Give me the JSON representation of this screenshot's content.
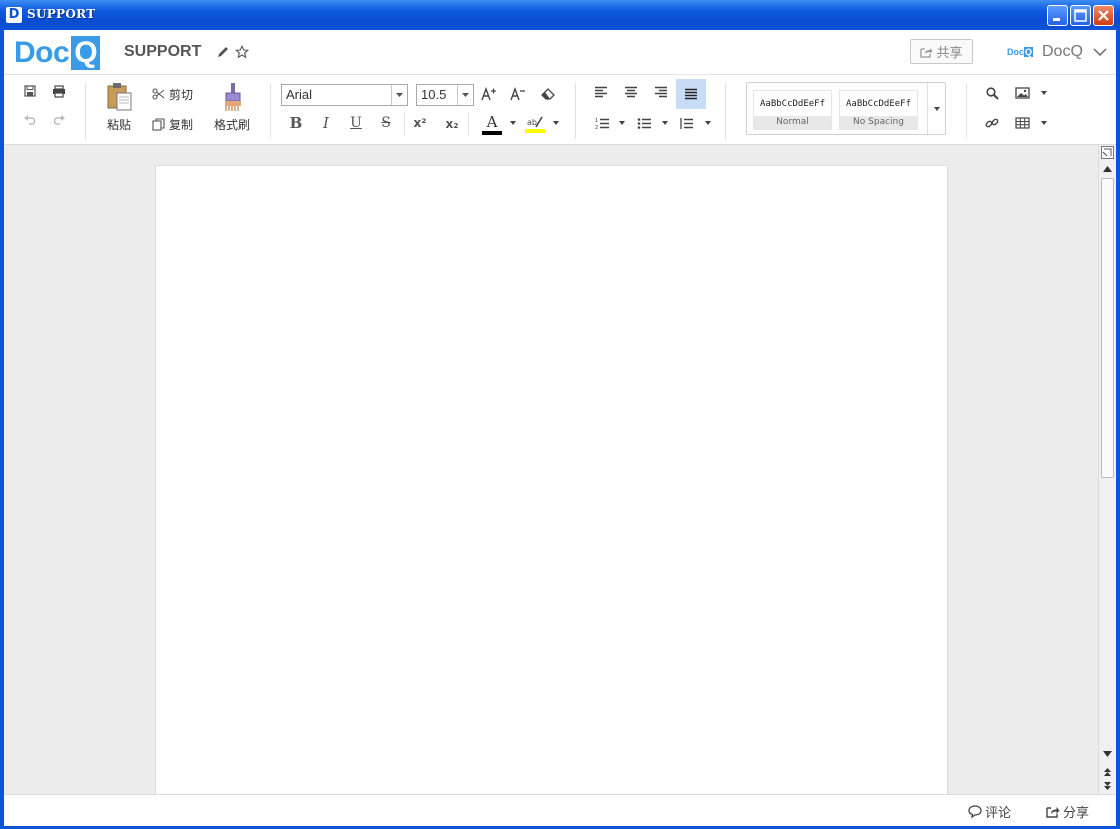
{
  "window": {
    "title": "SUPPORT",
    "app_icon_letter": "D"
  },
  "header": {
    "logo_text": "Doc",
    "logo_accent": "Q",
    "doc_title": "SUPPORT",
    "share_label": "共享",
    "user_logo_text": "Doc",
    "user_logo_accent": "Q",
    "username": "DocQ"
  },
  "toolbar": {
    "paste_label": "粘贴",
    "cut_label": "剪切",
    "copy_label": "复制",
    "format_painter_label": "格式刷",
    "font_name": "Arial",
    "font_size": "10.5",
    "styles": [
      {
        "sample": "AaBbCcDdEeFf",
        "name": "Normal"
      },
      {
        "sample": "AaBbCcDdEeFf",
        "name": "No Spacing"
      }
    ]
  },
  "statusbar": {
    "comment_label": "评论",
    "share_label": "分享"
  },
  "colors": {
    "accent": "#3a9be8",
    "font_color_bar": "#000000",
    "highlight_bar": "#ffff00",
    "active_align_bg": "#c9dcf5"
  }
}
